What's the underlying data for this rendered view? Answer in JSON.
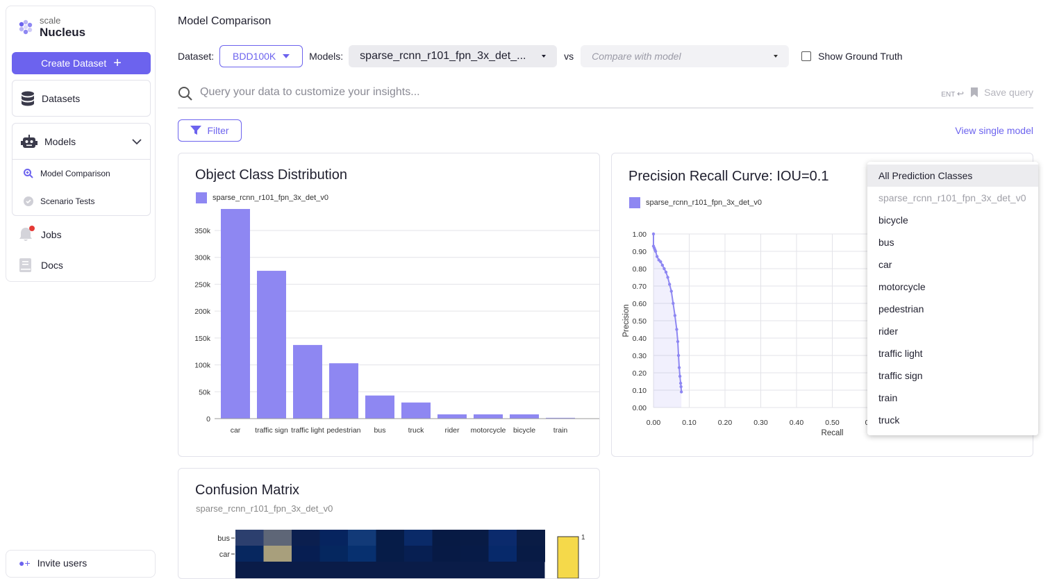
{
  "sidebar": {
    "logo_small": "scale",
    "logo_big": "Nucleus",
    "create_label": "Create Dataset",
    "datasets_label": "Datasets",
    "models_label": "Models",
    "model_items": [
      {
        "label": "Model Comparison",
        "icon": "search-plus-icon"
      },
      {
        "label": "Scenario Tests",
        "icon": "check-circle-icon"
      }
    ],
    "jobs_label": "Jobs",
    "docs_label": "Docs",
    "invite_label": "Invite users"
  },
  "header": {
    "title": "Model Comparison",
    "dataset_label": "Dataset:",
    "dataset_value": "BDD100K",
    "models_label": "Models:",
    "models_value": "sparse_rcnn_r101_fpn_3x_det_...",
    "vs_label": "vs",
    "compare_placeholder": "Compare with model",
    "ground_truth_label": "Show Ground Truth"
  },
  "search": {
    "placeholder": "Query your data to customize your insights...",
    "ent_label": "ENT",
    "save_label": "Save query"
  },
  "filter_label": "Filter",
  "view_single_label": "View single model",
  "colors": {
    "accent": "#6c63ee",
    "bar": "#8e87f2",
    "notification": "#e53935"
  },
  "cards": {
    "distribution_title": "Object Class Distribution",
    "pr_title": "Precision Recall Curve: IOU=0.1",
    "confusion_title": "Confusion Matrix",
    "confusion_subtitle": "sparse_rcnn_r101_fpn_3x_det_v0"
  },
  "dropdown": {
    "items": [
      "All Prediction Classes",
      "sparse_rcnn_r101_fpn_3x_det_v0",
      "bicycle",
      "bus",
      "car",
      "motorcycle",
      "pedestrian",
      "rider",
      "traffic light",
      "traffic sign",
      "train",
      "truck"
    ]
  },
  "chart_data": [
    {
      "type": "bar",
      "title": "Object Class Distribution",
      "series_name": "sparse_rcnn_r101_fpn_3x_det_v0",
      "categories": [
        "car",
        "traffic sign",
        "traffic light",
        "pedestrian",
        "bus",
        "truck",
        "rider",
        "motorcycle",
        "bicycle",
        "train"
      ],
      "values": [
        390000,
        275000,
        137000,
        103000,
        43000,
        30000,
        8000,
        8000,
        8000,
        1500
      ],
      "yticks": [
        "0",
        "50k",
        "100k",
        "150k",
        "200k",
        "250k",
        "300k",
        "350k"
      ],
      "ylim": [
        0,
        390000
      ],
      "grid": true
    },
    {
      "type": "line",
      "title": "Precision Recall Curve: IOU=0.1",
      "series_name": "sparse_rcnn_r101_fpn_3x_det_v0",
      "xlabel": "Recall",
      "ylabel": "Precision",
      "xticks": [
        "0.00",
        "0.10",
        "0.20",
        "0.30",
        "0.40",
        "0.50",
        "0."
      ],
      "yticks": [
        "0.00",
        "0.10",
        "0.20",
        "0.30",
        "0.40",
        "0.50",
        "0.60",
        "0.70",
        "0.80",
        "0.90",
        "1.00"
      ],
      "xlim": [
        0,
        0.6
      ],
      "ylim": [
        0,
        1.0
      ],
      "x": [
        0.0,
        0.0,
        0.002,
        0.004,
        0.006,
        0.01,
        0.015,
        0.02,
        0.025,
        0.03,
        0.035,
        0.04,
        0.045,
        0.05,
        0.055,
        0.06,
        0.065,
        0.068,
        0.07,
        0.072,
        0.074,
        0.076,
        0.077,
        0.078
      ],
      "y": [
        1.0,
        0.93,
        0.92,
        0.91,
        0.9,
        0.87,
        0.85,
        0.84,
        0.82,
        0.8,
        0.78,
        0.75,
        0.71,
        0.67,
        0.6,
        0.53,
        0.45,
        0.38,
        0.3,
        0.23,
        0.18,
        0.14,
        0.12,
        0.09
      ],
      "grid": true
    },
    {
      "type": "heatmap",
      "title": "Confusion Matrix",
      "ytick_labels": [
        "bus",
        "car"
      ],
      "colorbar_max": "1"
    }
  ]
}
